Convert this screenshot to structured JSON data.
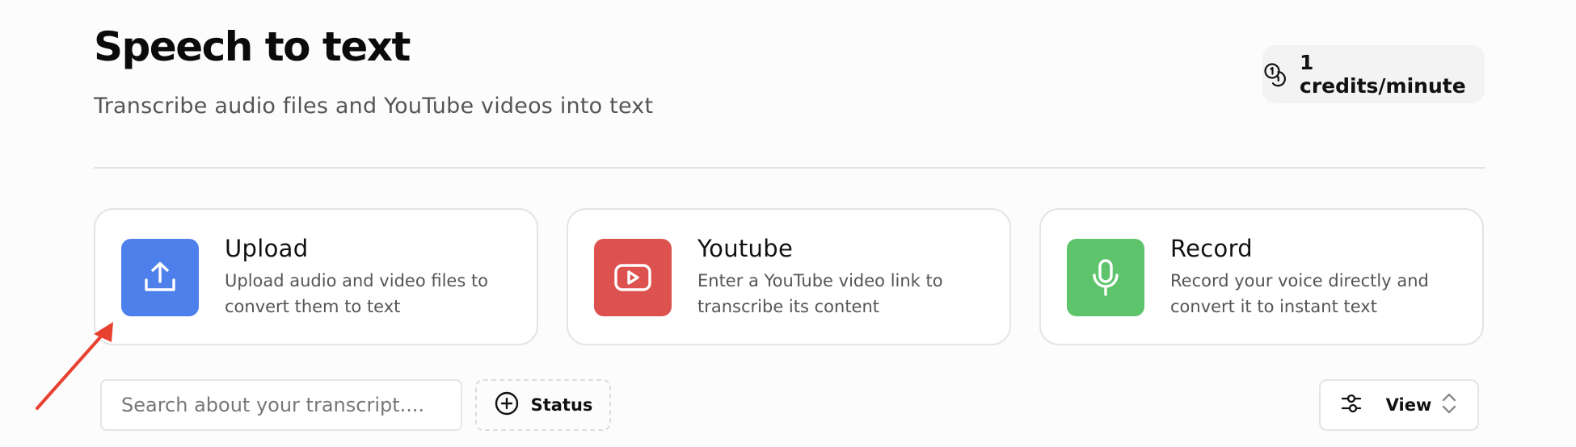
{
  "header": {
    "title": "Speech to text",
    "subtitle": "Transcribe audio files and YouTube videos into text",
    "credits_label": "1 credits/minute"
  },
  "cards": [
    {
      "title": "Upload",
      "description": "Upload audio and video files to convert them to text",
      "icon": "upload-icon",
      "color": "#4d80ea"
    },
    {
      "title": "Youtube",
      "description": "Enter a YouTube video link to transcribe its content",
      "icon": "youtube-icon",
      "color": "#dd524f"
    },
    {
      "title": "Record",
      "description": "Record your voice directly and convert it to instant text",
      "icon": "microphone-icon",
      "color": "#5ec46c"
    }
  ],
  "toolbar": {
    "search_placeholder": "Search about your transcript....",
    "status_label": "Status",
    "view_label": "View"
  },
  "colors": {
    "annotation_arrow": "#e8412f"
  }
}
